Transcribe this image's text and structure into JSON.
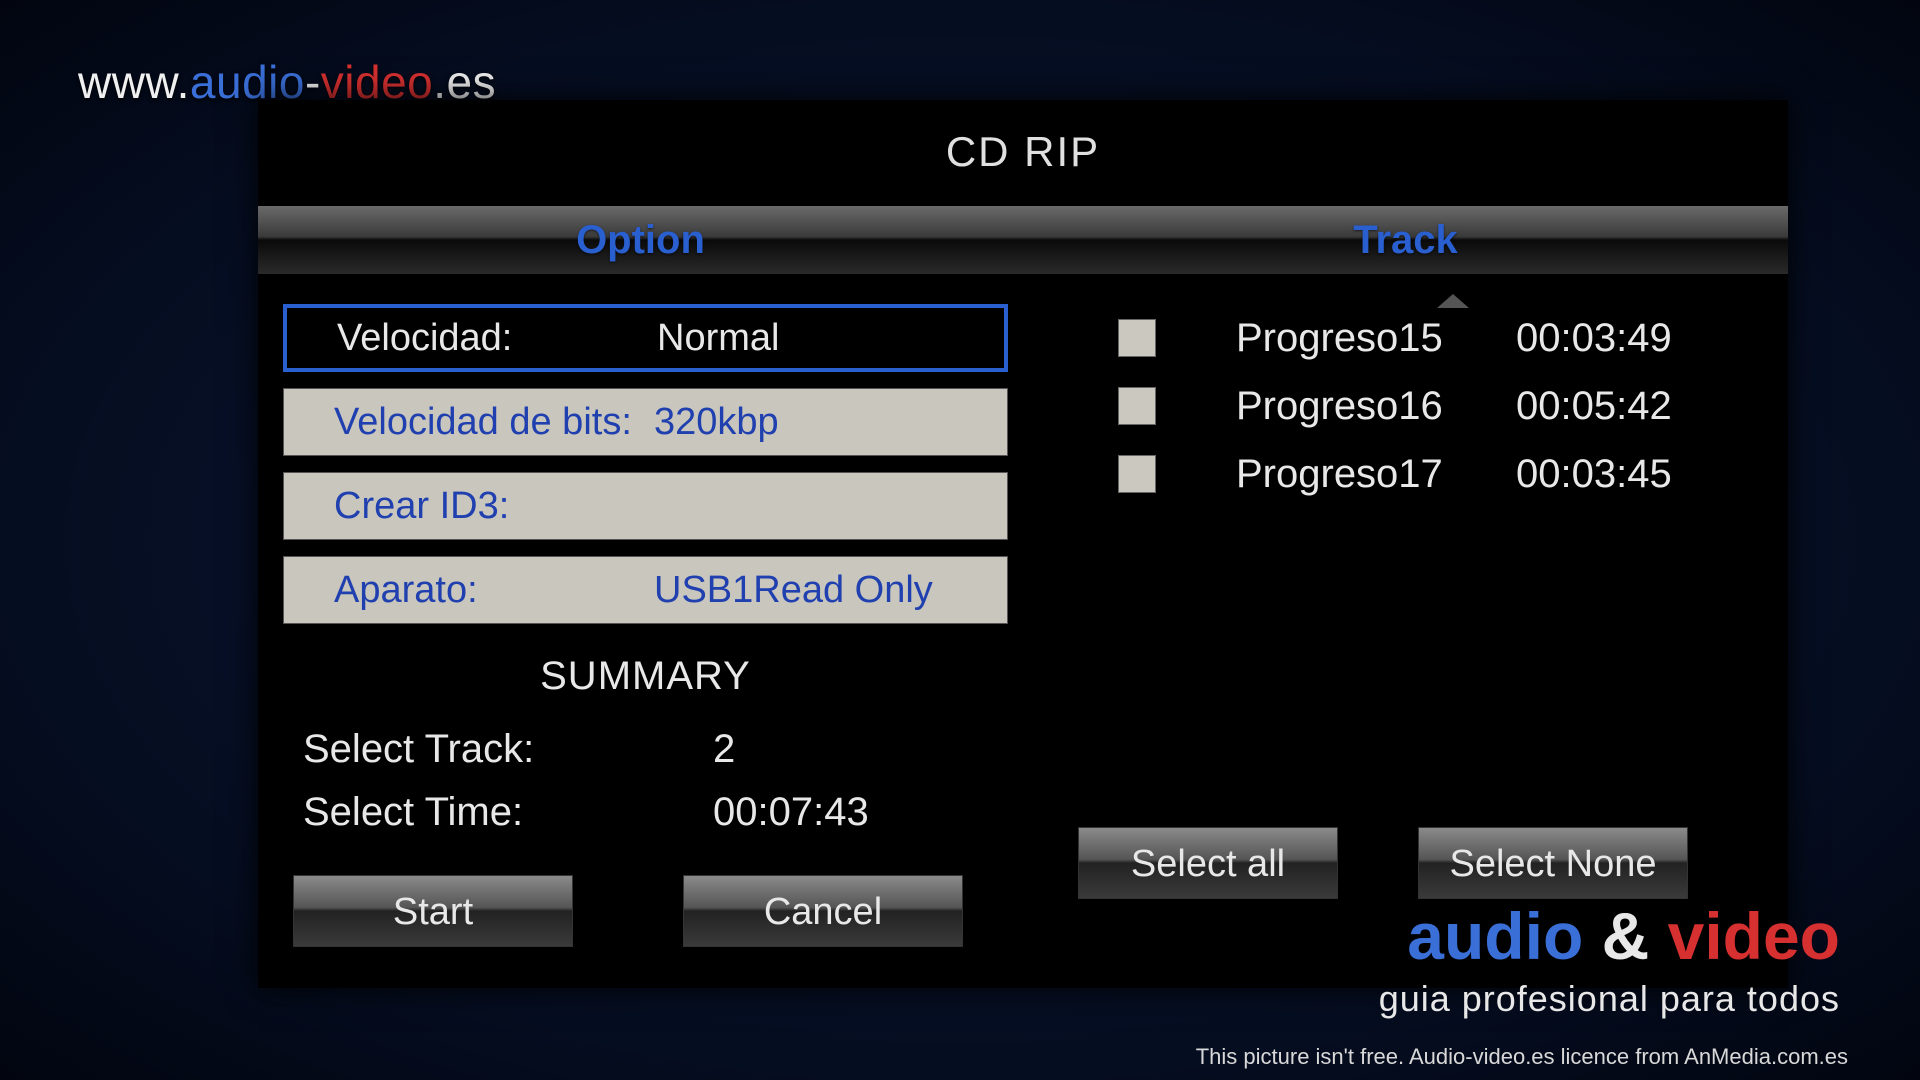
{
  "watermark": {
    "www": "www.",
    "audio": "audio",
    "dash": "-",
    "video": "video",
    "es": ".es"
  },
  "title": "CD RIP",
  "columns": {
    "option": "Option",
    "track": "Track"
  },
  "options": [
    {
      "label": "Velocidad:",
      "value": "Normal",
      "selected": true
    },
    {
      "label": "Velocidad de bits:",
      "value": "320kbp",
      "selected": false
    },
    {
      "label": "Crear ID3:",
      "value": "",
      "selected": false
    },
    {
      "label": "Aparato:",
      "value": "USB1Read Only",
      "selected": false
    }
  ],
  "summary": {
    "title": "SUMMARY",
    "rows": [
      {
        "label": "Select Track:",
        "value": "2"
      },
      {
        "label": "Select Time:",
        "value": "00:07:43"
      }
    ]
  },
  "buttons": {
    "start": "Start",
    "cancel": "Cancel",
    "select_all": "Select all",
    "select_none": "Select None"
  },
  "tracks": [
    {
      "name": "Progreso15",
      "time": "00:03:49",
      "checked": false
    },
    {
      "name": "Progreso16",
      "time": "00:05:42",
      "checked": false
    },
    {
      "name": "Progreso17",
      "time": "00:03:45",
      "checked": false
    }
  ],
  "logo": {
    "audio": "audio",
    "amp": " & ",
    "video": "video",
    "tagline": "guia profesional para todos"
  },
  "licence": "This picture isn't free. Audio-video.es licence from AnMedia.com.es"
}
